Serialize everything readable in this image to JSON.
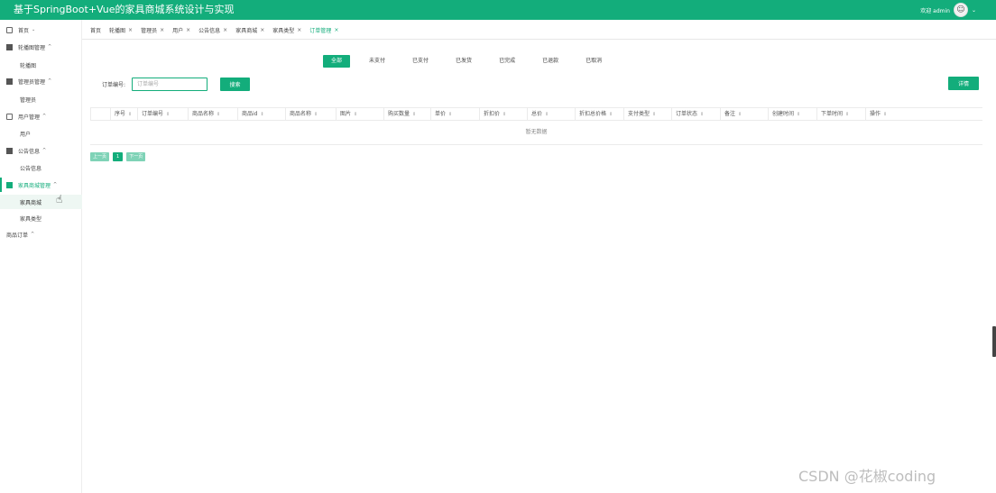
{
  "header": {
    "app_title": "基于SpringBoot+Vue的家具商城系统设计与实现",
    "user_greeting": "欢迎 admin"
  },
  "sidebar": {
    "items": [
      {
        "label": "首页",
        "type": "top",
        "icon": "home-icon"
      },
      {
        "label": "轮播图管理",
        "type": "group",
        "icon": "grid-icon"
      },
      {
        "label": "轮播图",
        "type": "sub"
      },
      {
        "label": "管理员管理",
        "type": "group",
        "icon": "grid-icon"
      },
      {
        "label": "管理员",
        "type": "sub"
      },
      {
        "label": "用户管理",
        "type": "group",
        "icon": "user-icon"
      },
      {
        "label": "用户",
        "type": "sub"
      },
      {
        "label": "公告信息",
        "type": "group",
        "icon": "grid-icon"
      },
      {
        "label": "公告信息",
        "type": "sub"
      },
      {
        "label": "家具商城管理",
        "type": "group",
        "icon": "shop-icon",
        "active": true
      },
      {
        "label": "家具商城",
        "type": "sub",
        "hover": true
      },
      {
        "label": "家具类型",
        "type": "sub"
      },
      {
        "label": "商品订单",
        "type": "plain"
      }
    ]
  },
  "tabs": [
    {
      "label": "首页",
      "closable": false
    },
    {
      "label": "轮播图",
      "closable": true
    },
    {
      "label": "管理员",
      "closable": true
    },
    {
      "label": "用户",
      "closable": true
    },
    {
      "label": "公告信息",
      "closable": true
    },
    {
      "label": "家具商城",
      "closable": true
    },
    {
      "label": "家具类型",
      "closable": true
    },
    {
      "label": "订单管理",
      "closable": true,
      "active": true
    }
  ],
  "status_filter": [
    "全部",
    "未支付",
    "已支付",
    "已发货",
    "已完成",
    "已退款",
    "已取消"
  ],
  "search": {
    "label": "订单编号:",
    "placeholder": "订单编号",
    "button": "搜索"
  },
  "detail_button": "详情",
  "table": {
    "columns": [
      "序号",
      "订单编号",
      "商品名称",
      "商品id",
      "商品名称",
      "图片",
      "购买数量",
      "单价",
      "折扣价",
      "总价",
      "折扣总价格",
      "支付类型",
      "订单状态",
      "备注",
      "创建时间",
      "下单时间",
      "操作"
    ],
    "empty_text": "暂无数据"
  },
  "pager": {
    "prev": "上一页",
    "current": "1",
    "next": "下一页"
  },
  "watermark": "CSDN @花椒coding",
  "colors": {
    "accent": "#13ad7b"
  }
}
